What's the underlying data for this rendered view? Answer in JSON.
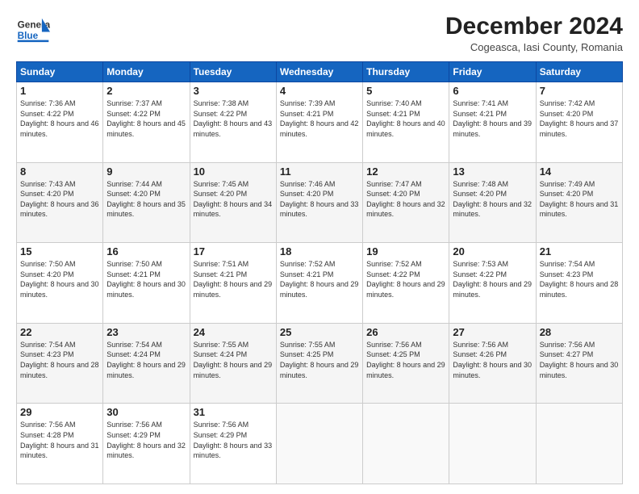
{
  "header": {
    "logo_general": "General",
    "logo_blue": "Blue",
    "title": "December 2024",
    "subtitle": "Cogeasca, Iasi County, Romania"
  },
  "days_of_week": [
    "Sunday",
    "Monday",
    "Tuesday",
    "Wednesday",
    "Thursday",
    "Friday",
    "Saturday"
  ],
  "weeks": [
    [
      {
        "day": "1",
        "sunrise": "7:36 AM",
        "sunset": "4:22 PM",
        "daylight": "8 hours and 46 minutes."
      },
      {
        "day": "2",
        "sunrise": "7:37 AM",
        "sunset": "4:22 PM",
        "daylight": "8 hours and 45 minutes."
      },
      {
        "day": "3",
        "sunrise": "7:38 AM",
        "sunset": "4:22 PM",
        "daylight": "8 hours and 43 minutes."
      },
      {
        "day": "4",
        "sunrise": "7:39 AM",
        "sunset": "4:21 PM",
        "daylight": "8 hours and 42 minutes."
      },
      {
        "day": "5",
        "sunrise": "7:40 AM",
        "sunset": "4:21 PM",
        "daylight": "8 hours and 40 minutes."
      },
      {
        "day": "6",
        "sunrise": "7:41 AM",
        "sunset": "4:21 PM",
        "daylight": "8 hours and 39 minutes."
      },
      {
        "day": "7",
        "sunrise": "7:42 AM",
        "sunset": "4:20 PM",
        "daylight": "8 hours and 37 minutes."
      }
    ],
    [
      {
        "day": "8",
        "sunrise": "7:43 AM",
        "sunset": "4:20 PM",
        "daylight": "8 hours and 36 minutes."
      },
      {
        "day": "9",
        "sunrise": "7:44 AM",
        "sunset": "4:20 PM",
        "daylight": "8 hours and 35 minutes."
      },
      {
        "day": "10",
        "sunrise": "7:45 AM",
        "sunset": "4:20 PM",
        "daylight": "8 hours and 34 minutes."
      },
      {
        "day": "11",
        "sunrise": "7:46 AM",
        "sunset": "4:20 PM",
        "daylight": "8 hours and 33 minutes."
      },
      {
        "day": "12",
        "sunrise": "7:47 AM",
        "sunset": "4:20 PM",
        "daylight": "8 hours and 32 minutes."
      },
      {
        "day": "13",
        "sunrise": "7:48 AM",
        "sunset": "4:20 PM",
        "daylight": "8 hours and 32 minutes."
      },
      {
        "day": "14",
        "sunrise": "7:49 AM",
        "sunset": "4:20 PM",
        "daylight": "8 hours and 31 minutes."
      }
    ],
    [
      {
        "day": "15",
        "sunrise": "7:50 AM",
        "sunset": "4:20 PM",
        "daylight": "8 hours and 30 minutes."
      },
      {
        "day": "16",
        "sunrise": "7:50 AM",
        "sunset": "4:21 PM",
        "daylight": "8 hours and 30 minutes."
      },
      {
        "day": "17",
        "sunrise": "7:51 AM",
        "sunset": "4:21 PM",
        "daylight": "8 hours and 29 minutes."
      },
      {
        "day": "18",
        "sunrise": "7:52 AM",
        "sunset": "4:21 PM",
        "daylight": "8 hours and 29 minutes."
      },
      {
        "day": "19",
        "sunrise": "7:52 AM",
        "sunset": "4:22 PM",
        "daylight": "8 hours and 29 minutes."
      },
      {
        "day": "20",
        "sunrise": "7:53 AM",
        "sunset": "4:22 PM",
        "daylight": "8 hours and 29 minutes."
      },
      {
        "day": "21",
        "sunrise": "7:54 AM",
        "sunset": "4:23 PM",
        "daylight": "8 hours and 28 minutes."
      }
    ],
    [
      {
        "day": "22",
        "sunrise": "7:54 AM",
        "sunset": "4:23 PM",
        "daylight": "8 hours and 28 minutes."
      },
      {
        "day": "23",
        "sunrise": "7:54 AM",
        "sunset": "4:24 PM",
        "daylight": "8 hours and 29 minutes."
      },
      {
        "day": "24",
        "sunrise": "7:55 AM",
        "sunset": "4:24 PM",
        "daylight": "8 hours and 29 minutes."
      },
      {
        "day": "25",
        "sunrise": "7:55 AM",
        "sunset": "4:25 PM",
        "daylight": "8 hours and 29 minutes."
      },
      {
        "day": "26",
        "sunrise": "7:56 AM",
        "sunset": "4:25 PM",
        "daylight": "8 hours and 29 minutes."
      },
      {
        "day": "27",
        "sunrise": "7:56 AM",
        "sunset": "4:26 PM",
        "daylight": "8 hours and 30 minutes."
      },
      {
        "day": "28",
        "sunrise": "7:56 AM",
        "sunset": "4:27 PM",
        "daylight": "8 hours and 30 minutes."
      }
    ],
    [
      {
        "day": "29",
        "sunrise": "7:56 AM",
        "sunset": "4:28 PM",
        "daylight": "8 hours and 31 minutes."
      },
      {
        "day": "30",
        "sunrise": "7:56 AM",
        "sunset": "4:29 PM",
        "daylight": "8 hours and 32 minutes."
      },
      {
        "day": "31",
        "sunrise": "7:56 AM",
        "sunset": "4:29 PM",
        "daylight": "8 hours and 33 minutes."
      },
      null,
      null,
      null,
      null
    ]
  ],
  "labels": {
    "sunrise": "Sunrise:",
    "sunset": "Sunset:",
    "daylight": "Daylight:"
  },
  "colors": {
    "header_bg": "#1565c0",
    "accent": "#1565c0"
  }
}
